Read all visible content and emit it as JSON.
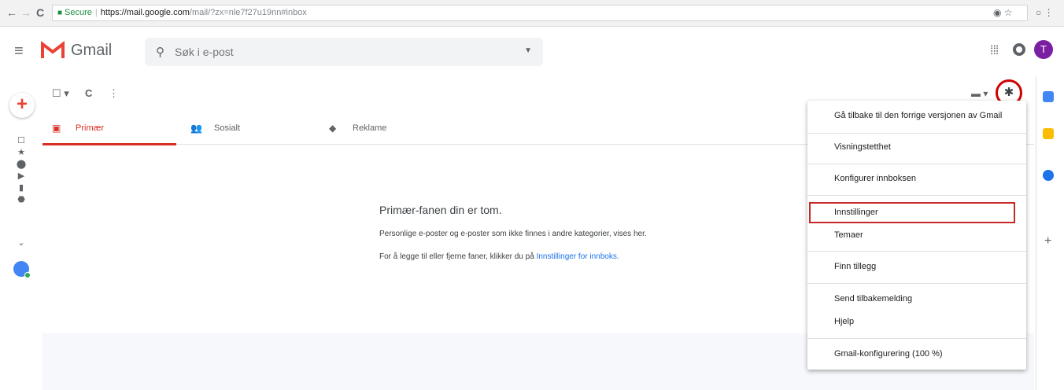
{
  "browser": {
    "back_icon": "←",
    "forward_icon": "→",
    "reload_icon": "C",
    "secure_label": "Secure",
    "url_host": "https://mail.google.com",
    "url_path": "/mail/?zx=nle7f27u19nn#inbox",
    "right_icons": "◉ ☆",
    "menu_icons": "○ ⋮"
  },
  "header": {
    "menu_icon": "≡",
    "title": "Gmail",
    "search_placeholder": "Søk i e-post",
    "search_icon": "⚲",
    "search_dropdown_icon": "▼",
    "apps_icon": "⁞⁞⁞",
    "account_initial": "T"
  },
  "toolbar": {
    "select_icon": "☐ ▾",
    "refresh_icon": "C",
    "more_icon": "⋮",
    "view_icon": "▬ ▾",
    "settings_icon": "✱"
  },
  "rail": {
    "compose_icon": "+",
    "icons": [
      "☐",
      "★",
      "⬤",
      "▶",
      "▮",
      "⬣",
      "⌄"
    ]
  },
  "tabs": [
    {
      "label": "Primær",
      "icon": "▣"
    },
    {
      "label": "Sosialt",
      "icon": "👥"
    },
    {
      "label": "Reklame",
      "icon": "◆"
    }
  ],
  "empty": {
    "title": "Primær-fanen din er tom.",
    "line1": "Personlige e-poster og e-poster som ikke finnes i andre kategorier, vises her.",
    "line2_prefix": "For å legge til eller fjerne faner, klikker du på",
    "line2_link": "Innstillinger for innboks."
  },
  "menu": {
    "items": [
      "Gå tilbake til den forrige versjonen av Gmail",
      "Visningstetthet",
      "Konfigurer innboksen",
      "Innstillinger",
      "Temaer",
      "Finn tillegg",
      "Send tilbakemelding",
      "Hjelp",
      "Gmail-konfigurering (100 %)"
    ]
  },
  "sidepanel": {
    "add_icon": "+"
  },
  "colors": {
    "accent_red": "#d93025",
    "highlight_red": "#c62828",
    "link_blue": "#1a73e8"
  }
}
